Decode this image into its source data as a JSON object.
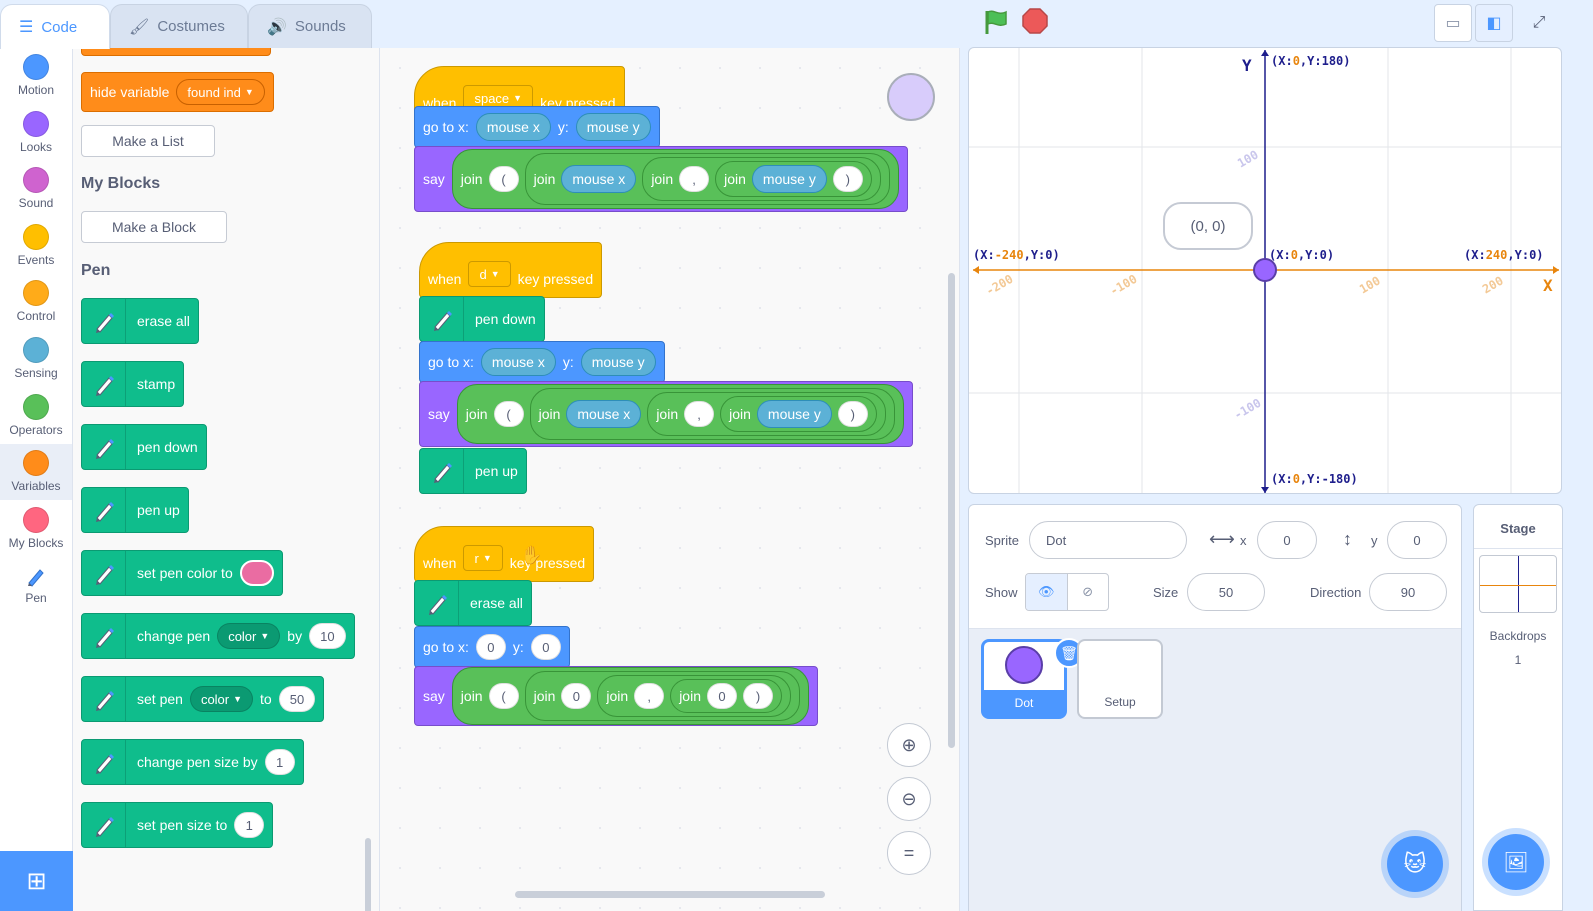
{
  "tabs": {
    "code": "Code",
    "costumes": "Costumes",
    "sounds": "Sounds"
  },
  "categories": [
    {
      "label": "Motion",
      "color": "#4c97ff"
    },
    {
      "label": "Looks",
      "color": "#9966ff"
    },
    {
      "label": "Sound",
      "color": "#cf63cf"
    },
    {
      "label": "Events",
      "color": "#ffbf00"
    },
    {
      "label": "Control",
      "color": "#ffab19"
    },
    {
      "label": "Sensing",
      "color": "#5cb1d6"
    },
    {
      "label": "Operators",
      "color": "#59c059"
    },
    {
      "label": "Variables",
      "color": "#ff8c1a"
    },
    {
      "label": "My Blocks",
      "color": "#ff6680"
    },
    {
      "label": "Pen",
      "color": "#0fbd8c"
    }
  ],
  "palette": {
    "hide_variable": "hide variable",
    "hide_variable_target": "found ind",
    "make_list": "Make a List",
    "my_blocks_heading": "My Blocks",
    "make_block": "Make a Block",
    "pen_heading": "Pen",
    "erase_all": "erase all",
    "stamp": "stamp",
    "pen_down": "pen down",
    "pen_up": "pen up",
    "set_pen_color_to": "set pen color to",
    "change_pen": "change pen",
    "change_pen_param": "color",
    "change_pen_by": "by",
    "change_pen_value": "10",
    "set_pen": "set pen",
    "set_pen_param": "color",
    "set_pen_to": "to",
    "set_pen_value": "50",
    "change_pen_size_by": "change pen size by",
    "change_pen_size_value": "1",
    "set_pen_size_to": "set pen size to",
    "set_pen_size_value": "1"
  },
  "scripts": {
    "when": "when",
    "key_pressed": "key pressed",
    "key_space": "space",
    "key_d": "d",
    "key_r": "r",
    "go_to_x": "go to x:",
    "y": "y:",
    "mouse_x": "mouse x",
    "mouse_y": "mouse y",
    "say": "say",
    "join": "join",
    "open_paren": "(",
    "comma": ",",
    "close_paren": ")",
    "pen_down": "pen down",
    "pen_up": "pen up",
    "erase_all": "erase all",
    "zero": "0"
  },
  "stage": {
    "y_axis": "Y",
    "x_axis": "X",
    "top": {
      "prefix": "(X:",
      "x": "0",
      "mid": ",Y:",
      "y": "180",
      "suffix": ")"
    },
    "bottom": {
      "prefix": "(X:",
      "x": "0",
      "mid": ",Y:",
      "y": "-180",
      "suffix": ")"
    },
    "left": {
      "prefix": "(X:",
      "x": "-240",
      "mid": ",Y:",
      "y": "0",
      "suffix": ")"
    },
    "right": {
      "prefix": "(X:",
      "x": "240",
      "mid": ",Y:",
      "y": "0",
      "suffix": ")"
    },
    "center": {
      "prefix": "(X:",
      "x": "0",
      "mid": ",Y:",
      "y": "0",
      "suffix": ")"
    },
    "tick_neg200": "-200",
    "tick_neg100": "-100",
    "tick_100x": "100",
    "tick_200x": "200",
    "tick_100y": "100",
    "tick_neg100y": "-100",
    "speech": "(0, 0)"
  },
  "sprite_info": {
    "sprite_label": "Sprite",
    "sprite_name": "Dot",
    "x_label": "x",
    "x_value": "0",
    "y_label": "y",
    "y_value": "0",
    "show_label": "Show",
    "size_label": "Size",
    "size_value": "50",
    "direction_label": "Direction",
    "direction_value": "90"
  },
  "sprites": [
    {
      "name": "Dot"
    },
    {
      "name": "Setup"
    }
  ],
  "stage_pane": {
    "title": "Stage",
    "backdrops_label": "Backdrops",
    "backdrops_count": "1"
  },
  "colors": {
    "motion": "#4c97ff",
    "looks": "#9966ff",
    "events": "#ffbf00",
    "pen": "#0fbd8c",
    "variables": "#ff8c1a",
    "operators": "#59c059",
    "sensing": "#5cb1d6",
    "dot": "#9966ff",
    "pen_color": "#ea6ca2"
  }
}
